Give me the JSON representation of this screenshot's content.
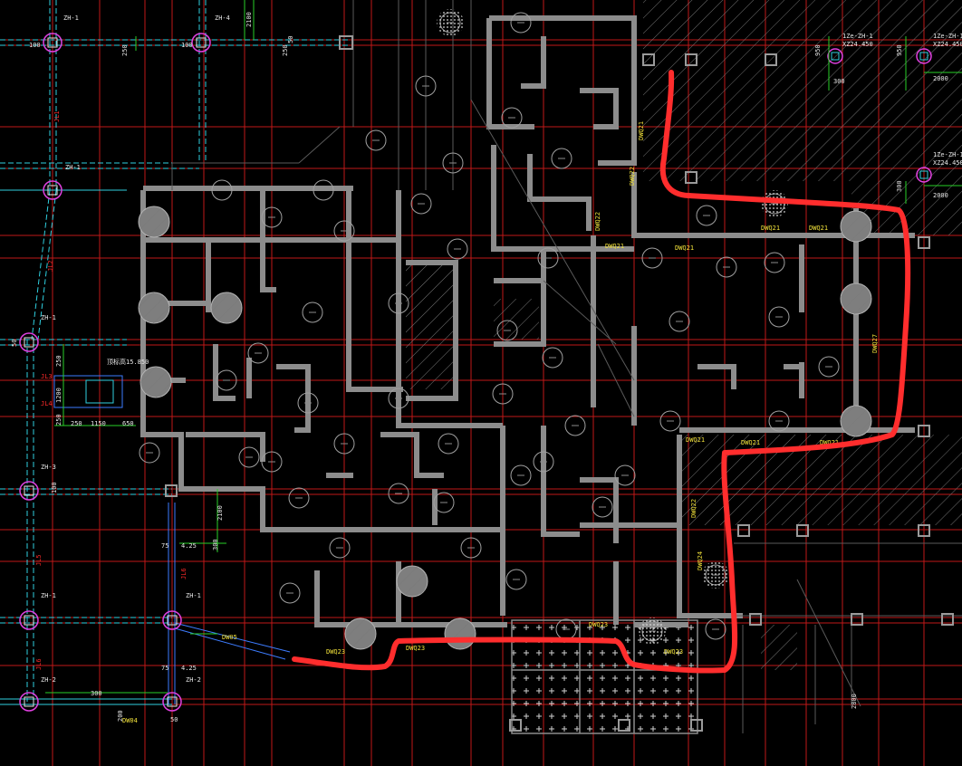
{
  "canvas": {
    "title": "",
    "background": "#000000"
  },
  "colors": {
    "grid_red": "#c01818",
    "wall_gray": "#8c8c8c",
    "wall_light": "#b4b4b4",
    "beam_cyan": "#2fd0e0",
    "beam_blue": "#3d7cff",
    "dim_green": "#27d127",
    "text_yellow": "#f0e03a",
    "text_red": "#ff2a2a",
    "text_white": "#e6e6e6",
    "column_magenta": "#e040e0",
    "markup_red": "#ff2d2d",
    "pile_gray": "#a0a0a0"
  },
  "labels": {
    "zh1": "ZH-1",
    "zh2": "ZH-2",
    "zh3": "ZH-3",
    "zh4": "ZH-4",
    "zh1_top_right": "1Ze-ZH-1",
    "zh1_top_right_sub": "XZ24.450",
    "zh2_right": "1Ze-ZH-1",
    "zh2_right_sub": "XZ24.450",
    "dw021": "DWQ21",
    "dw022": "DWQ22",
    "dw023": "DWQ23",
    "dw024": "DWQ24",
    "dw027": "DWQ27",
    "dw05": "DW05",
    "dw04": "DW04",
    "elev": "顶标高15.850",
    "jl1": "JL1",
    "jl2": "JL2",
    "jl3": "JL3",
    "jl4": "JL4",
    "jl5": "JL5",
    "jl6": "JL6",
    "dim_100": "100",
    "dim_250": "250",
    "dim_50": "50",
    "dim_2100": "2100",
    "dim_2000": "2000",
    "dim_300": "300",
    "dim_950": "950",
    "dim_1200": "1200",
    "dim_1150": "1150",
    "dim_650": "650",
    "dim_75": "75",
    "dim_425": "4.25",
    "dim_200": "200",
    "dim_2800": "2800"
  }
}
